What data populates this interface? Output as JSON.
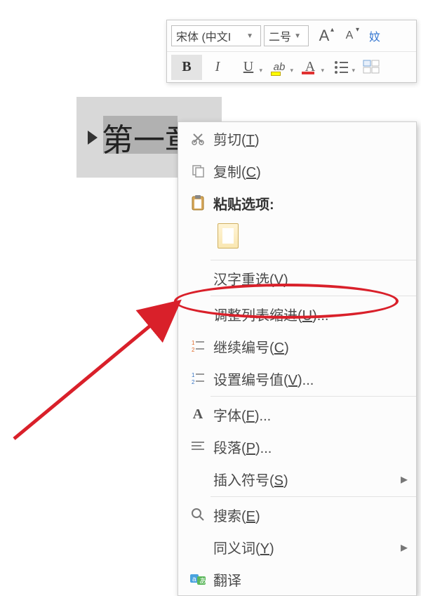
{
  "toolbar": {
    "font_name": "宋体 (中文I",
    "font_size": "二号",
    "grow_font": "A",
    "shrink_font": "A",
    "wenzi": "妏",
    "bold": "B",
    "italic": "I",
    "underline": "U",
    "highlight": "ab",
    "font_color": "A"
  },
  "document": {
    "text": "第一章"
  },
  "context_menu": {
    "cut": "剪切(T)",
    "copy": "复制(C)",
    "paste_header": "粘贴选项:",
    "hanzi_reselect": "汉字重选(V)",
    "adjust_list_indent": "调整列表缩进(U)...",
    "continue_numbering": "继续编号(C)",
    "set_numbering_value": "设置编号值(V)...",
    "font": "字体(F)...",
    "paragraph": "段落(P)...",
    "insert_symbol": "插入符号(S)",
    "search": "搜索(E)",
    "thesaurus": "同义词(Y)",
    "translate": "翻译"
  },
  "icons": {
    "cut": "scissors",
    "copy": "copy",
    "paste": "clipboard",
    "continue_numbering": "numbering-continue",
    "set_numbering": "numbering-set",
    "font": "A",
    "paragraph": "paragraph-lines",
    "search": "magnifier",
    "translate": "translate-aあ"
  },
  "annotation": {
    "highlighted_item": "adjust_list_indent"
  }
}
